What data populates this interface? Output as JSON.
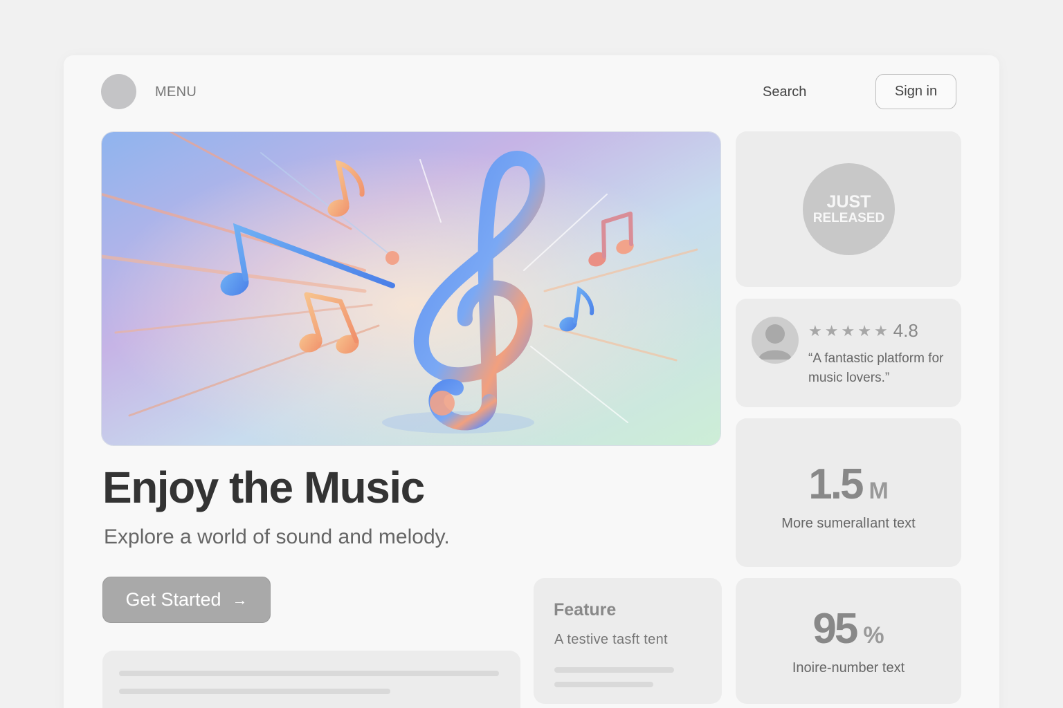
{
  "header": {
    "menu_label": "MENU",
    "search_label": "Search",
    "signin_label": "Sign in"
  },
  "hero": {
    "image_desc_icon": "music-notes-illustration",
    "title": "Enjoy the Music",
    "subtitle": "Explore a world of sound and melody.",
    "cta_label": "Get Started",
    "cta_icon": "→"
  },
  "feature_card": {
    "title": "Feature",
    "text": "A testive tasft tent"
  },
  "released_card": {
    "line1": "JUST",
    "line2": "RELEASED"
  },
  "review_card": {
    "stars": 5,
    "rating": "4.8",
    "quote": "“A fantastic platform for music lovers.”"
  },
  "stat1": {
    "value": "1.5",
    "unit": "M",
    "label": "More sumeralIant text"
  },
  "stat2": {
    "value": "95",
    "unit": "%",
    "label": "Inoire-number text"
  },
  "colors": {
    "page_bg": "#f1f1f1",
    "card_bg": "#ececec",
    "cta_bg": "#a9a9a9",
    "badge_bg": "#c8c8c8"
  }
}
